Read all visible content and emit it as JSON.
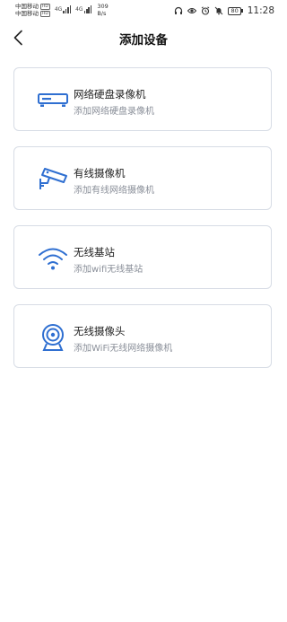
{
  "status_bar": {
    "carrier1": "中国移动",
    "carrier2": "中国移动",
    "hd_badge": "HD",
    "net1": "4G",
    "net2": "4G",
    "speed_value": "309",
    "speed_unit": "B/s",
    "battery": "80",
    "time": "11:28"
  },
  "navbar": {
    "title": "添加设备",
    "back_icon": "chevron-left-icon"
  },
  "accent_color": "#2f6fd1",
  "devices": [
    {
      "icon": "nvr-recorder-icon",
      "title": "网络硬盘录像机",
      "subtitle": "添加网络硬盘录像机"
    },
    {
      "icon": "wired-camera-icon",
      "title": "有线摄像机",
      "subtitle": "添加有线网络摄像机"
    },
    {
      "icon": "wifi-icon",
      "title": "无线基站",
      "subtitle": "添加wifi无线基站"
    },
    {
      "icon": "wireless-camera-icon",
      "title": "无线摄像头",
      "subtitle": "添加WiFi无线网络摄像机"
    }
  ]
}
